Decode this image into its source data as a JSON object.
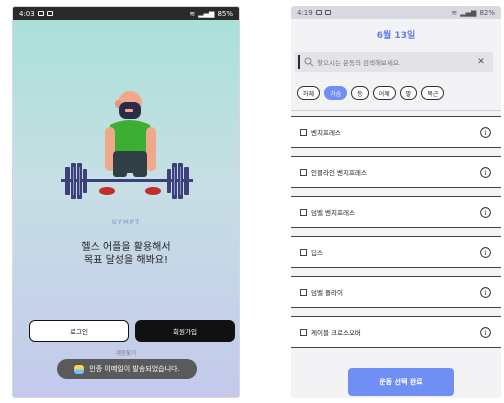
{
  "left_screen": {
    "status": {
      "time": "4:03",
      "battery": "85%"
    },
    "brand": "GYMPT",
    "headline_line1": "헬스 어플을 활용해서",
    "headline_line2": "목표 달성을 해봐요!",
    "login_label": "로그인",
    "signup_label": "회원가입",
    "under_text": "계정찾기",
    "toast_text": "인증 이메일이 발송되었습니다.",
    "colors": {
      "bg_top": "#a7e0d6",
      "bg_bottom": "#c3c9ec",
      "shirt": "#3cae34"
    }
  },
  "right_screen": {
    "status": {
      "time": "4:19",
      "battery": "82%"
    },
    "date_title": "6월 13일",
    "search": {
      "placeholder": "찾으시는 운동의 검색해보세요."
    },
    "chips": [
      {
        "label": "하체",
        "selected": false
      },
      {
        "label": "가슴",
        "selected": true
      },
      {
        "label": "등",
        "selected": false
      },
      {
        "label": "어깨",
        "selected": false
      },
      {
        "label": "팔",
        "selected": false
      },
      {
        "label": "복근",
        "selected": false
      }
    ],
    "exercises": [
      {
        "name": "벤치프레스"
      },
      {
        "name": "인클라인 벤치프레스"
      },
      {
        "name": "덤벨 벤치프레스"
      },
      {
        "name": "딥스"
      },
      {
        "name": "덤벨 플라이"
      },
      {
        "name": "케이블 크로스오버"
      }
    ],
    "confirm_label": "운동 선택 완료",
    "colors": {
      "accent": "#6f8ff5"
    }
  }
}
